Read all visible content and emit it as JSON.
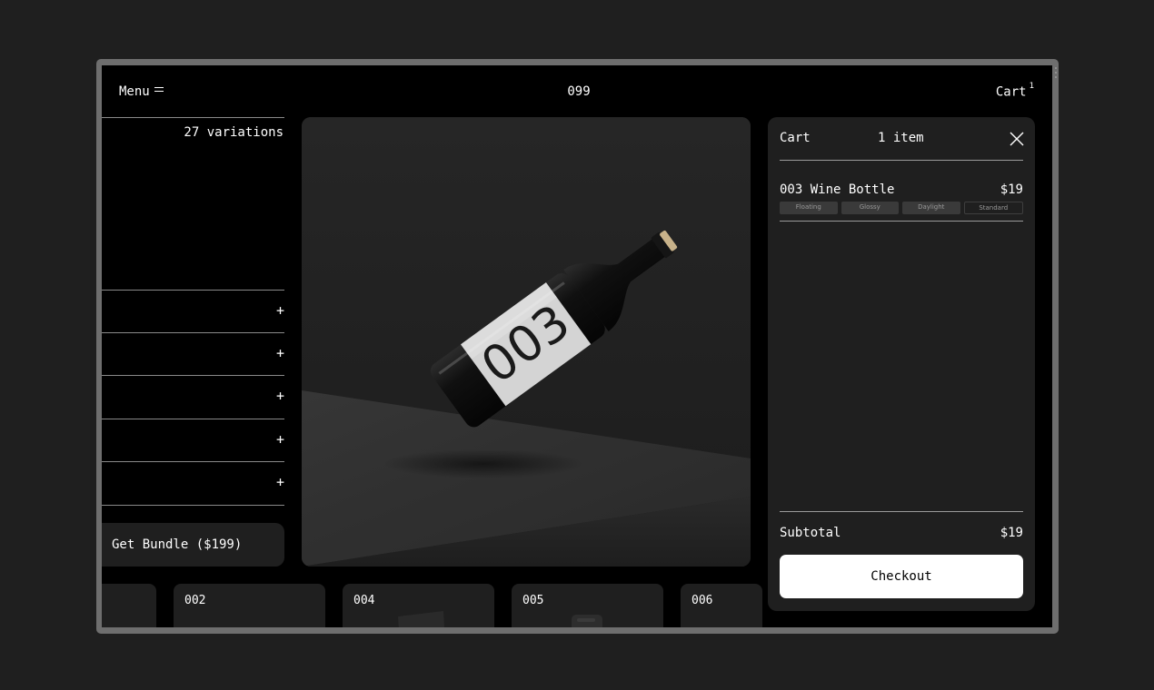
{
  "header": {
    "menu_label": "Menu",
    "title": "099",
    "cart_label": "Cart",
    "cart_count": "1"
  },
  "left_panel": {
    "variations": "27 variations",
    "accordion_plus": "+",
    "bundle_label": "Get Bundle ($199)"
  },
  "product": {
    "label_text": "003"
  },
  "thumbnails": [
    {
      "label": ""
    },
    {
      "label": "002"
    },
    {
      "label": "004"
    },
    {
      "label": "005"
    },
    {
      "label": "006"
    }
  ],
  "cart": {
    "title": "Cart",
    "count_label": "1 item",
    "item": {
      "name": "003 Wine Bottle",
      "price": "$19",
      "tags": [
        "Floating",
        "Glossy",
        "Daylight",
        "Standard"
      ]
    },
    "subtotal_label": "Subtotal",
    "subtotal_value": "$19",
    "checkout_label": "Checkout"
  },
  "colors": {
    "page_bg": "#1f1f1f",
    "screen_bg": "#000000",
    "panel_bg": "#1f1f1f",
    "accent": "#ffffff"
  }
}
